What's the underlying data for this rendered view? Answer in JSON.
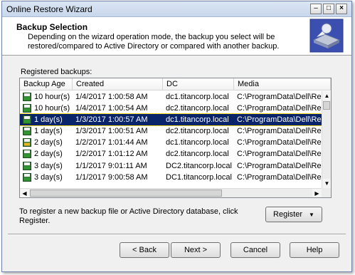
{
  "window": {
    "title": "Online Restore Wizard"
  },
  "header": {
    "title": "Backup Selection",
    "description": "Depending on the wizard operation mode, the backup you select will be restored/compared to Active Directory or compared with another backup."
  },
  "list": {
    "label": "Registered backups:",
    "columns": [
      "Backup Age",
      "Created",
      "DC",
      "Media"
    ],
    "rows": [
      {
        "age": "10 hour(s)",
        "created": "1/4/2017 1:00:58 AM",
        "dc": "dc1.titancorp.local",
        "media": "C:\\ProgramData\\Dell\\Re",
        "icon": "backup-green-icon"
      },
      {
        "age": "10 hour(s)",
        "created": "1/4/2017 1:00:54 AM",
        "dc": "dc2.titancorp.local",
        "media": "C:\\ProgramData\\Dell\\Re",
        "icon": "backup-green-icon"
      },
      {
        "age": "1 day(s)",
        "created": "1/3/2017 1:00:57 AM",
        "dc": "dc1.titancorp.local",
        "media": "C:\\ProgramData\\Dell\\Re",
        "icon": "backup-green-icon",
        "selected": true
      },
      {
        "age": "1 day(s)",
        "created": "1/3/2017 1:00:51 AM",
        "dc": "dc2.titancorp.local",
        "media": "C:\\ProgramData\\Dell\\Re",
        "icon": "backup-green-icon"
      },
      {
        "age": "2 day(s)",
        "created": "1/2/2017 1:01:44 AM",
        "dc": "dc1.titancorp.local",
        "media": "C:\\ProgramData\\Dell\\Re",
        "icon": "backup-yellow-icon"
      },
      {
        "age": "2 day(s)",
        "created": "1/2/2017 1:01:12 AM",
        "dc": "dc2.titancorp.local",
        "media": "C:\\ProgramData\\Dell\\Re",
        "icon": "backup-green-icon"
      },
      {
        "age": "3 day(s)",
        "created": "1/1/2017 9:01:11 AM",
        "dc": "DC2.titancorp.local",
        "media": "C:\\ProgramData\\Dell\\Re",
        "icon": "backup-green-icon"
      },
      {
        "age": "3 day(s)",
        "created": "1/1/2017 9:00:58 AM",
        "dc": "DC1.titancorp.local",
        "media": "C:\\ProgramData\\Dell\\Re",
        "icon": "backup-green-icon"
      }
    ]
  },
  "footer_note": "To register a new backup file or Active Directory database, click Register.",
  "buttons": {
    "register": "Register",
    "back": "< Back",
    "next": "Next >",
    "cancel": "Cancel",
    "help": "Help"
  },
  "colors": {
    "selection": "#0a246a",
    "backup_green": "#2e9a2e",
    "backup_yellow": "#e8b820"
  }
}
